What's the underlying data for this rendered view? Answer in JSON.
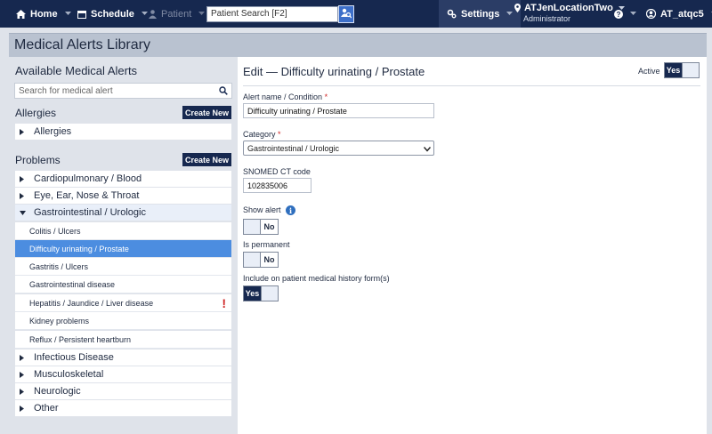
{
  "nav": {
    "home": "Home",
    "schedule": "Schedule",
    "patient": "Patient",
    "search_placeholder": "Patient Search [F2]",
    "settings": "Settings",
    "location": "ATJenLocationTwo",
    "role": "Administrator",
    "user": "AT_atqc5"
  },
  "page": {
    "title": "Medical Alerts Library"
  },
  "left": {
    "heading": "Available Medical Alerts",
    "search_placeholder": "Search for medical alert",
    "allergies_heading": "Allergies",
    "allergies_create": "Create New",
    "allergies_groups": [
      "Allergies"
    ],
    "problems_heading": "Problems",
    "problems_create": "Create New",
    "groups": [
      "Cardiopulmonary / Blood",
      "Eye, Ear, Nose & Throat",
      "Gastrointestinal / Urologic",
      "Infectious Disease",
      "Musculoskeletal",
      "Neurologic",
      "Other"
    ],
    "gi_items": [
      "Colitis / Ulcers",
      "Difficulty urinating / Prostate",
      "Gastritis / Ulcers",
      "Gastrointestinal disease",
      "Hepatitis / Jaundice / Liver disease",
      "Kidney problems",
      "Reflux / Persistent heartburn"
    ],
    "warning_mark": "!"
  },
  "form": {
    "title": "Edit — Difficulty urinating / Prostate",
    "active_label": "Active",
    "active_value": "Yes",
    "alert_name_label": "Alert name / Condition",
    "alert_name_value": "Difficulty urinating / Prostate",
    "required_mark": "*",
    "category_label": "Category",
    "category_value": "Gastrointestinal / Urologic",
    "snomed_label": "SNOMED CT code",
    "snomed_value": "102835006",
    "show_alert_label": "Show alert",
    "show_alert_value": "No",
    "is_permanent_label": "Is permanent",
    "is_permanent_value": "No",
    "include_label": "Include on patient medical history form(s)",
    "include_value": "Yes",
    "info_glyph": "i"
  },
  "colors": {
    "nav_bg": "#16284f",
    "selected_row": "#4c8de0",
    "required": "#d02828"
  },
  "icons": [
    "home-icon",
    "calendar-icon",
    "person-icon",
    "user-search-icon",
    "gear-icon",
    "map-pin-icon",
    "help-icon",
    "user-account-icon",
    "search-icon",
    "info-icon"
  ]
}
